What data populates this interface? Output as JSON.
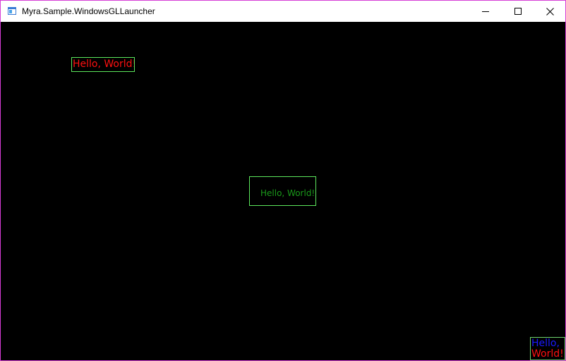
{
  "window": {
    "title": "Myra.Sample.WindowsGLLauncher",
    "border_color": "#d63cd6",
    "background_color": "#000000"
  },
  "titlebar": {
    "icon": "app-window-icon",
    "minimize_icon": "minimize-icon",
    "maximize_icon": "maximize-icon",
    "close_icon": "close-icon"
  },
  "labels": [
    {
      "text": "Hello, World!",
      "text_color": "#ff1010",
      "border_color": "#5ce65c",
      "placement": "top-left"
    },
    {
      "text": "Hello, World!",
      "text_color": "#1a9a1a",
      "border_color": "#5ce65c",
      "placement": "center"
    },
    {
      "text_line1": "Hello,",
      "text_line2": "World!",
      "text_color_line1": "#1a1aff",
      "text_color_line2": "#ff1010",
      "border_color": "#6ed26e",
      "placement": "bottom-right"
    }
  ]
}
